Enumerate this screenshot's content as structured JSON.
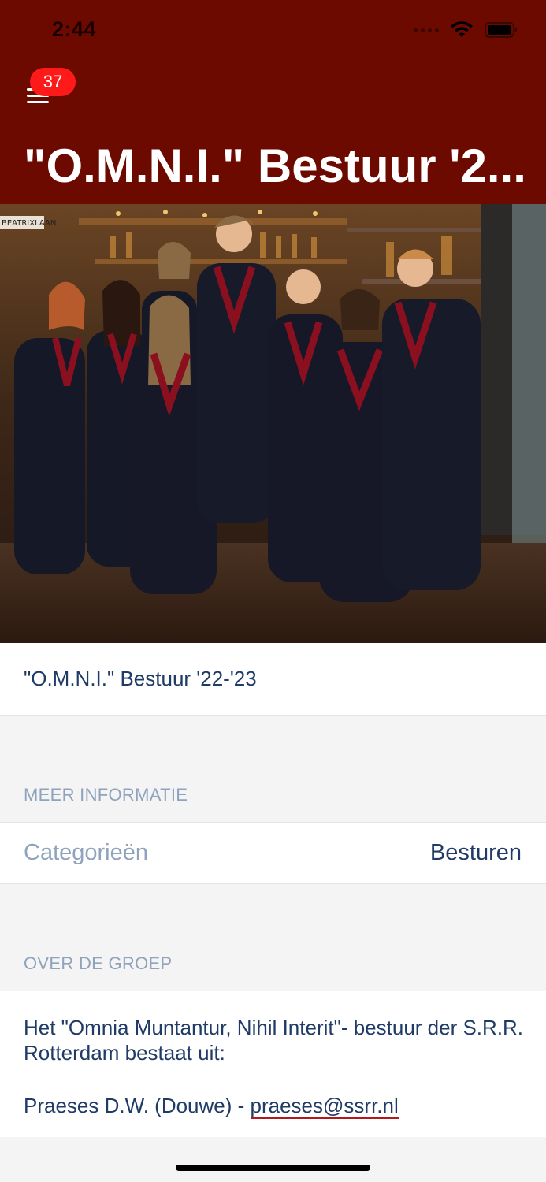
{
  "status": {
    "time": "2:44"
  },
  "header": {
    "notification_count": "37",
    "title": "\"O.M.N.I.\" Bestuur '2..."
  },
  "photo": {
    "sign_text": "BEATRIXLAAN"
  },
  "group": {
    "name": "\"O.M.N.I.\" Bestuur '22-'23"
  },
  "more_info": {
    "section_label": "MEER INFORMATIE",
    "category_key": "Categorieën",
    "category_value": "Besturen"
  },
  "about": {
    "section_label": "OVER DE GROEP",
    "intro": "Het \"Omnia Muntantur, Nihil Interit\"- bestuur der S.R.R. Rotterdam bestaat uit:",
    "line_prefix": "Praeses D.W. (Douwe) - ",
    "email": "praeses@ssrr.nl"
  },
  "colors": {
    "header": "#6d0a00",
    "text": "#1f3b66",
    "muted": "#8fa3bd",
    "badge": "#ff1a1a"
  }
}
